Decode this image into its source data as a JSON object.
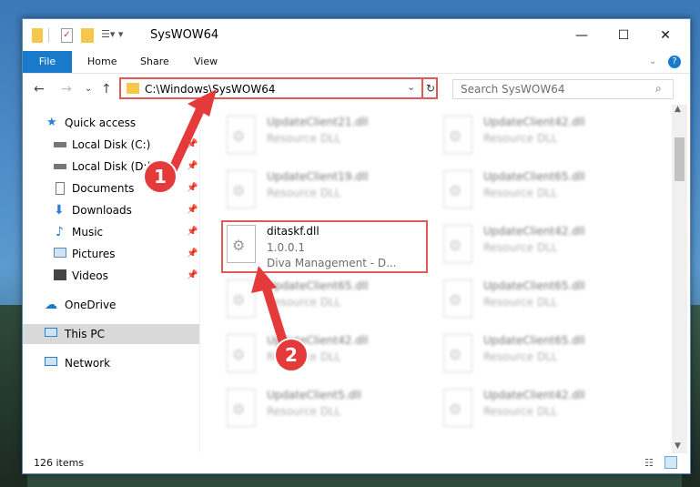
{
  "window": {
    "title": "SysWOW64"
  },
  "ribbon": {
    "tabs": [
      {
        "label": "File"
      },
      {
        "label": "Home"
      },
      {
        "label": "Share"
      },
      {
        "label": "View"
      }
    ]
  },
  "address": {
    "path": "C:\\Windows\\SysWOW64"
  },
  "search": {
    "placeholder": "Search SysWOW64"
  },
  "nav": {
    "quick_access": "Quick access",
    "items": [
      {
        "label": "Local Disk (C:)"
      },
      {
        "label": "Local Disk (D:)"
      },
      {
        "label": "Documents"
      },
      {
        "label": "Downloads"
      },
      {
        "label": "Music"
      },
      {
        "label": "Pictures"
      },
      {
        "label": "Videos"
      }
    ],
    "onedrive": "OneDrive",
    "this_pc": "This PC",
    "network": "Network"
  },
  "files": {
    "highlighted": {
      "name": "ditaskf.dll",
      "version": "1.0.0.1",
      "desc": "Diva Management - D..."
    },
    "left": [
      {
        "name": "UpdateClient21.dll",
        "type": "Resource DLL"
      },
      {
        "name": "UpdateClient19.dll",
        "type": "Resource DLL"
      },
      {
        "name": "UpdateClient65.dll",
        "type": "Resource DLL"
      },
      {
        "name": "UpdateClient42.dll",
        "type": "Resource DLL"
      },
      {
        "name": "UpdateClient5.dll",
        "type": "Resource DLL"
      }
    ],
    "right": [
      {
        "name": "UpdateClient42.dll",
        "type": "Resource DLL"
      },
      {
        "name": "UpdateClient65.dll",
        "type": "Resource DLL"
      },
      {
        "name": "UpdateClient42.dll",
        "type": "Resource DLL"
      },
      {
        "name": "UpdateClient65.dll",
        "type": "Resource DLL"
      },
      {
        "name": "UpdateClient65.dll",
        "type": "Resource DLL"
      },
      {
        "name": "UpdateClient42.dll",
        "type": "Resource DLL"
      }
    ]
  },
  "status": {
    "item_count": "126 items"
  },
  "callouts": {
    "one": "1",
    "two": "2"
  },
  "colors": {
    "accent": "#1979ca",
    "callout": "#e53a3a",
    "highlight_border": "#e05a5a"
  }
}
